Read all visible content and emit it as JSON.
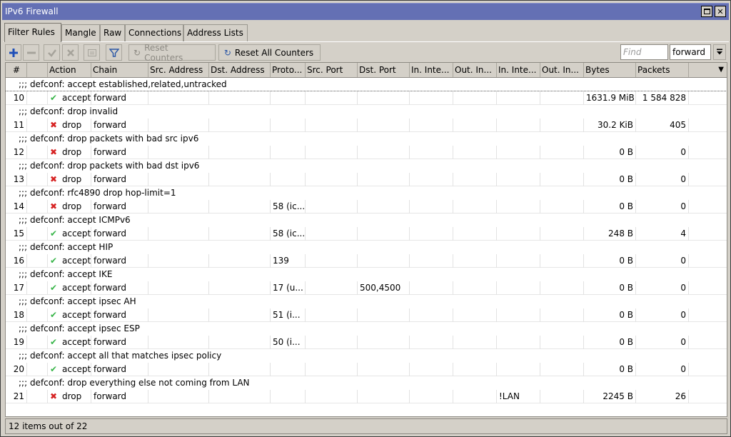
{
  "window": {
    "title": "IPv6 Firewall"
  },
  "tabs": [
    {
      "label": "Filter Rules",
      "active": true
    },
    {
      "label": "Mangle",
      "active": false
    },
    {
      "label": "Raw",
      "active": false
    },
    {
      "label": "Connections",
      "active": false
    },
    {
      "label": "Address Lists",
      "active": false
    }
  ],
  "toolbar": {
    "reset_counters": "Reset Counters",
    "reset_all_counters": "Reset All Counters",
    "find_placeholder": "Find",
    "chain_filter": "forward"
  },
  "columns": [
    "#",
    "Action",
    "Chain",
    "Src. Address",
    "Dst. Address",
    "Proto...",
    "Src. Port",
    "Dst. Port",
    "In. Inte...",
    "Out. In...",
    "In. Inte...",
    "Out. In...",
    "Bytes",
    "Packets"
  ],
  "rules": [
    {
      "comment": ";;; defconf: accept established,related,untracked",
      "num": "10",
      "action": "accept",
      "chain": "forward",
      "proto": "",
      "dst_port": "",
      "in_iface_list": "",
      "bytes": "1631.9 MiB",
      "packets": "1 584 828"
    },
    {
      "comment": ";;; defconf: drop invalid",
      "num": "11",
      "action": "drop",
      "chain": "forward",
      "proto": "",
      "dst_port": "",
      "in_iface_list": "",
      "bytes": "30.2 KiB",
      "packets": "405"
    },
    {
      "comment": ";;; defconf: drop packets with bad src ipv6",
      "num": "12",
      "action": "drop",
      "chain": "forward",
      "proto": "",
      "dst_port": "",
      "in_iface_list": "",
      "bytes": "0 B",
      "packets": "0"
    },
    {
      "comment": ";;; defconf: drop packets with bad dst ipv6",
      "num": "13",
      "action": "drop",
      "chain": "forward",
      "proto": "",
      "dst_port": "",
      "in_iface_list": "",
      "bytes": "0 B",
      "packets": "0"
    },
    {
      "comment": ";;; defconf: rfc4890 drop hop-limit=1",
      "num": "14",
      "action": "drop",
      "chain": "forward",
      "proto": "58 (ic...",
      "dst_port": "",
      "in_iface_list": "",
      "bytes": "0 B",
      "packets": "0"
    },
    {
      "comment": ";;; defconf: accept ICMPv6",
      "num": "15",
      "action": "accept",
      "chain": "forward",
      "proto": "58 (ic...",
      "dst_port": "",
      "in_iface_list": "",
      "bytes": "248 B",
      "packets": "4"
    },
    {
      "comment": ";;; defconf: accept HIP",
      "num": "16",
      "action": "accept",
      "chain": "forward",
      "proto": "139",
      "dst_port": "",
      "in_iface_list": "",
      "bytes": "0 B",
      "packets": "0"
    },
    {
      "comment": ";;; defconf: accept IKE",
      "num": "17",
      "action": "accept",
      "chain": "forward",
      "proto": "17 (u...",
      "dst_port": "500,4500",
      "in_iface_list": "",
      "bytes": "0 B",
      "packets": "0"
    },
    {
      "comment": ";;; defconf: accept ipsec AH",
      "num": "18",
      "action": "accept",
      "chain": "forward",
      "proto": "51 (i...",
      "dst_port": "",
      "in_iface_list": "",
      "bytes": "0 B",
      "packets": "0"
    },
    {
      "comment": ";;; defconf: accept ipsec ESP",
      "num": "19",
      "action": "accept",
      "chain": "forward",
      "proto": "50 (i...",
      "dst_port": "",
      "in_iface_list": "",
      "bytes": "0 B",
      "packets": "0"
    },
    {
      "comment": ";;; defconf: accept all that matches ipsec policy",
      "num": "20",
      "action": "accept",
      "chain": "forward",
      "proto": "",
      "dst_port": "",
      "in_iface_list": "",
      "bytes": "0 B",
      "packets": "0"
    },
    {
      "comment": ";;; defconf: drop everything else not coming from LAN",
      "num": "21",
      "action": "drop",
      "chain": "forward",
      "proto": "",
      "dst_port": "",
      "in_iface_list": "!LAN",
      "bytes": "2245 B",
      "packets": "26"
    }
  ],
  "status": {
    "text": "12 items out of 22"
  },
  "colors": {
    "titlebar": "#6470b4",
    "accept": "#39b54a",
    "drop": "#d62222",
    "add": "#1f4fb8"
  }
}
